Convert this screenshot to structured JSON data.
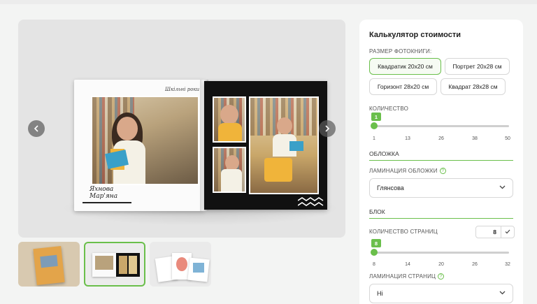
{
  "gallery": {
    "book_title_handwritten": "Шкільні роки",
    "book_name_handwritten": "Яхнова Мар'яна",
    "prev_icon": "chevron-left-icon",
    "next_icon": "chevron-right-icon",
    "thumbnails": [
      {
        "name": "thumbnail-book-cover"
      },
      {
        "name": "thumbnail-open-book",
        "selected": true
      },
      {
        "name": "thumbnail-book-pages"
      }
    ]
  },
  "calculator": {
    "title": "Калькулятор стоимости",
    "size_label": "РАЗМЕР ФОТОКНИГИ:",
    "sizes": [
      {
        "label": "Квадратик 20x20 см",
        "active": true
      },
      {
        "label": "Портрет 20x28 см",
        "active": false
      },
      {
        "label": "Горизонт 28x20 см",
        "active": false
      },
      {
        "label": "Квадрат 28x28 см",
        "active": false
      }
    ],
    "quantity_label": "КОЛИЧЕСТВО",
    "quantity_value": "1",
    "quantity_ticks": [
      "1",
      "13",
      "26",
      "38",
      "50"
    ],
    "cover_section": "ОБЛОЖКА",
    "cover_lamination_label": "ЛАМИНАЦИЯ ОБЛОЖКИ",
    "cover_lamination_value": "Глянсова",
    "block_section": "БЛОК",
    "pages_label": "КОЛИЧЕСТВО СТРАНИЦ",
    "pages_value": "8",
    "pages_ticks": [
      "8",
      "14",
      "20",
      "26",
      "32"
    ],
    "pages_lamination_label": "ЛАМИНАЦИЯ СТРАНИЦ",
    "pages_lamination_value": "Ні",
    "accent_color": "#6abf4b"
  }
}
